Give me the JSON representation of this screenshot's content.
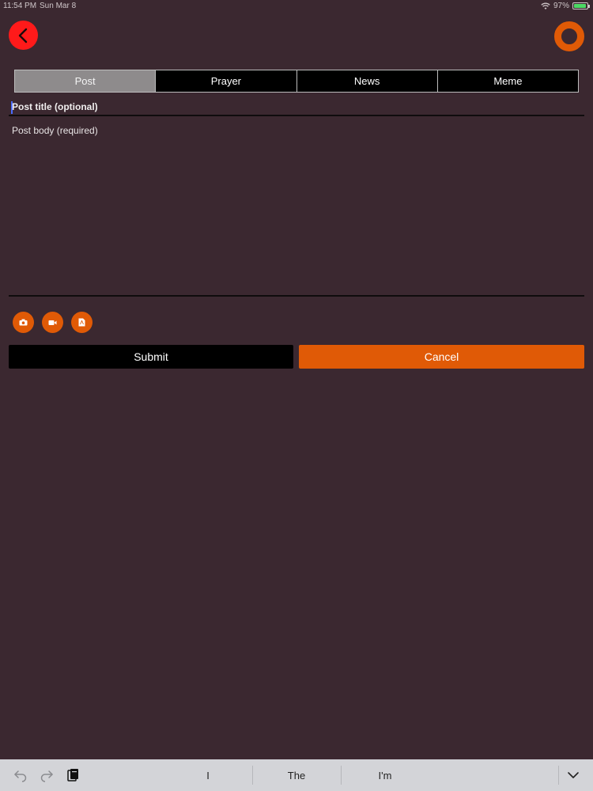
{
  "status_bar": {
    "time": "11:54 PM",
    "date": "Sun Mar 8",
    "battery": "97%"
  },
  "header": {
    "back_icon": "chevron-left-icon",
    "logo_icon": "ring-logo"
  },
  "tabs": [
    {
      "label": "Post",
      "active": true
    },
    {
      "label": "Prayer",
      "active": false
    },
    {
      "label": "News",
      "active": false
    },
    {
      "label": "Meme",
      "active": false
    }
  ],
  "form": {
    "title_placeholder": "Post title (optional)",
    "body_placeholder": "Post body (required)"
  },
  "attachments": [
    {
      "icon": "camera-icon"
    },
    {
      "icon": "video-icon"
    },
    {
      "icon": "document-icon"
    }
  ],
  "actions": {
    "submit_label": "Submit",
    "cancel_label": "Cancel"
  },
  "keyboard_bar": {
    "suggestions": [
      "I",
      "The",
      "I'm"
    ]
  },
  "colors": {
    "background": "#3b2830",
    "accent": "#e05a06",
    "back_button": "#ff1a1a"
  }
}
